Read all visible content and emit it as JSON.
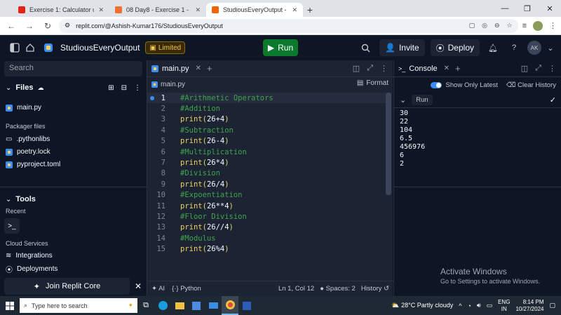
{
  "browser": {
    "tabs": [
      {
        "title": "Exercise 1: Calculator using Pyth",
        "icon_color": "#e62117"
      },
      {
        "title": "08 Day8 - Exercise 1 - Create a",
        "icon_color": "#f07030"
      },
      {
        "title": "StudiousEveryOutput - Replit",
        "icon_color": "#f26207"
      }
    ],
    "url": "replit.com/@Ashish-Kumar176/StudiousEveryOutput"
  },
  "header": {
    "repl_name": "StudiousEveryOutput",
    "limited_label": "Limited",
    "run_label": "Run",
    "invite_label": "Invite",
    "deploy_label": "Deploy",
    "avatar_initials": "AK"
  },
  "sidebar": {
    "search_placeholder": "Search",
    "files_label": "Files",
    "files": [
      "main.py"
    ],
    "packager_label": "Packager files",
    "packager_files": [
      ".pythonlibs",
      "poetry.lock",
      "pyproject.toml"
    ],
    "tools_label": "Tools",
    "recent_label": "Recent",
    "cloud_label": "Cloud Services",
    "integrations_label": "Integrations",
    "deployments_label": "Deployments",
    "join_label": "Join Replit Core"
  },
  "editor": {
    "tab_label": "main.py",
    "crumb": "main.py",
    "format_label": "Format",
    "lines": [
      {
        "n": "1",
        "type": "comment",
        "text": "#Arithmetic Operators"
      },
      {
        "n": "2",
        "type": "comment",
        "text": "#Addition"
      },
      {
        "n": "3",
        "type": "code",
        "text": "print(26+4)"
      },
      {
        "n": "4",
        "type": "comment",
        "text": "#Subtraction"
      },
      {
        "n": "5",
        "type": "code",
        "text": "print(26-4)"
      },
      {
        "n": "6",
        "type": "comment",
        "text": "#Multiplication"
      },
      {
        "n": "7",
        "type": "code",
        "text": "print(26*4)"
      },
      {
        "n": "8",
        "type": "comment",
        "text": "#Division"
      },
      {
        "n": "9",
        "type": "code",
        "text": "print(26/4)"
      },
      {
        "n": "10",
        "type": "comment",
        "text": "#Expoentiation"
      },
      {
        "n": "11",
        "type": "code",
        "text": "print(26**4)"
      },
      {
        "n": "12",
        "type": "comment",
        "text": "#Floor Division"
      },
      {
        "n": "13",
        "type": "code",
        "text": "print(26//4)"
      },
      {
        "n": "14",
        "type": "comment",
        "text": "#Modulus"
      },
      {
        "n": "15",
        "type": "code",
        "text": "print(26%4)"
      }
    ],
    "status": {
      "ai": "AI",
      "language": "Python",
      "position": "Ln 1, Col 12",
      "spaces": "Spaces: 2",
      "history": "History"
    }
  },
  "console": {
    "tab_label": "Console",
    "show_only_latest": "Show Only Latest",
    "clear_history": "Clear History",
    "run_label": "Run",
    "output": [
      "30",
      "22",
      "104",
      "6.5",
      "456976",
      "6",
      "2"
    ]
  },
  "watermark": {
    "title": "Activate Windows",
    "subtitle": "Go to Settings to activate Windows."
  },
  "taskbar": {
    "search_placeholder": "Type here to search",
    "weather": "28°C  Partly cloudy",
    "lang_top": "ENG",
    "lang_bottom": "IN",
    "time": "8:14 PM",
    "date": "10/27/2024"
  }
}
